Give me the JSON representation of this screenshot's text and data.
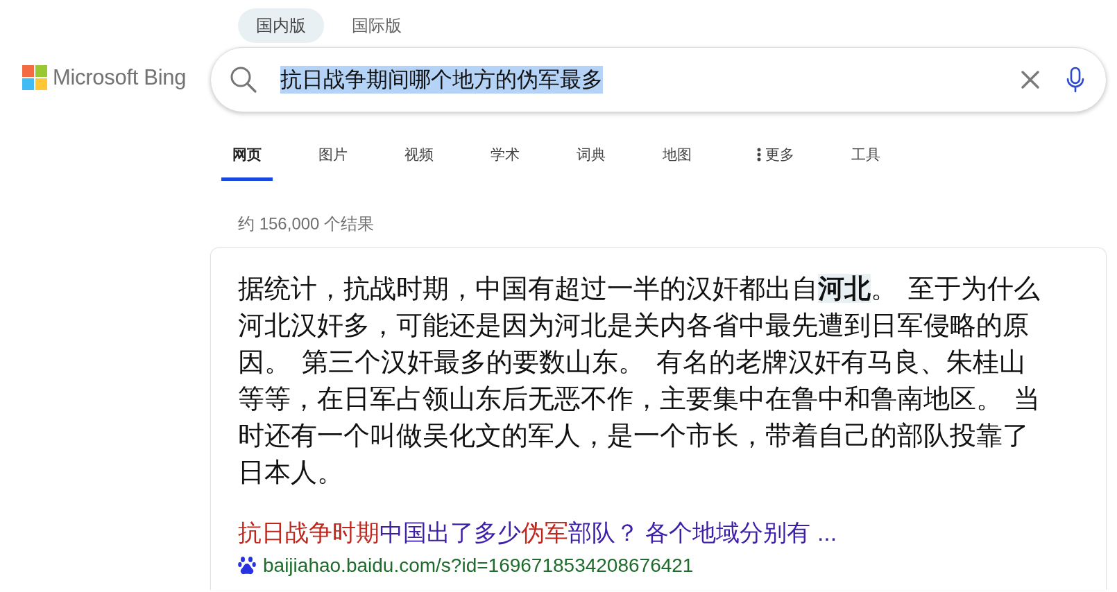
{
  "edition_tabs": [
    {
      "label": "国内版",
      "selected": true
    },
    {
      "label": "国际版",
      "selected": false
    }
  ],
  "logo": {
    "text": "Microsoft Bing"
  },
  "search": {
    "value": "抗日战争期间哪个地方的伪军最多",
    "text_selected": true
  },
  "nav_tabs": [
    {
      "label": "网页",
      "selected": true,
      "kind": "tab"
    },
    {
      "label": "图片",
      "selected": false,
      "kind": "tab"
    },
    {
      "label": "视频",
      "selected": false,
      "kind": "tab"
    },
    {
      "label": "学术",
      "selected": false,
      "kind": "tab"
    },
    {
      "label": "词典",
      "selected": false,
      "kind": "tab"
    },
    {
      "label": "地图",
      "selected": false,
      "kind": "tab"
    },
    {
      "label": "更多",
      "selected": false,
      "kind": "menu"
    },
    {
      "label": "工具",
      "selected": false,
      "kind": "tab"
    }
  ],
  "result_count": "约 156,000 个结果",
  "answer": {
    "text": "据统计，抗战时期，中国有超过一半的汉奸都出自**河北**。 至于为什么河北汉奸多，可能还是因为河北是关内各省中最先遭到日军侵略的原因。 第三个汉奸最多的要数山东。 有名的老牌汉奸有马良、朱桂山等等，在日军占领山东后无恶不作，主要集中在鲁中和鲁南地区。 当时还有一个叫做吴化文的军人，是一个市长，带着自己的部队投靠了日本人。"
  },
  "result": {
    "title_parts": [
      {
        "text": "抗日战争时期",
        "match": true
      },
      {
        "text": "中国出了多少",
        "match": false
      },
      {
        "text": "伪军",
        "match": true
      },
      {
        "text": "部队？ 各个地域分别有 ...",
        "match": false
      }
    ],
    "url": "baijiahao.baidu.com/s?id=1696718534208676421"
  }
}
